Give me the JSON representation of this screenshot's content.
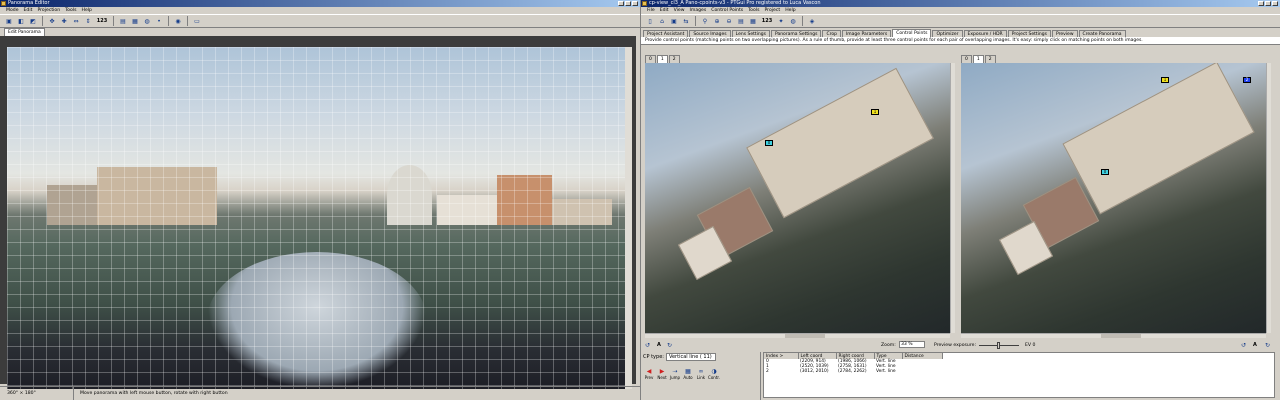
{
  "left_window": {
    "title": "Panorama Editor",
    "menu": [
      "Mode",
      "Edit",
      "Projection",
      "Tools",
      "Help"
    ],
    "toolbar": {
      "icons": [
        "preview-icon",
        "layers-icon",
        "center-icon",
        "fit-icon",
        "straighten-icon",
        "numbers-icon"
      ],
      "numbers_label": "123"
    },
    "tab": "Edit Panorama",
    "status": {
      "projection": "360° × 180° Equirectangular",
      "hint": "Move panorama with left mouse button, rotate with right button"
    }
  },
  "right_window": {
    "title": "cp-view_cl3_A Pano-cpoints-v3 - PTGui Pro registered to Luca Vascon",
    "menu": [
      "File",
      "Edit",
      "View",
      "Images",
      "Control Points",
      "Tools",
      "Project",
      "Help"
    ],
    "toolbar": {
      "numbers_label": "123"
    },
    "tabs": [
      "Project Assistant",
      "Source Images",
      "Lens Settings",
      "Panorama Settings",
      "Crop",
      "Image Parameters",
      "Control Points",
      "Optimizer",
      "Exposure / HDR",
      "Project Settings",
      "Preview",
      "Create Panorama"
    ],
    "active_tab": "Control Points",
    "description": "Provide control points (matching points on two overlapping pictures). As a rule of thumb, provide at least three control points for each pair of overlapping images. It's easy: simply click on matching points on both images.",
    "left_panel": {
      "tabs": [
        "0",
        "1",
        "2"
      ],
      "active": "1",
      "points": [
        "0",
        "1",
        "2"
      ]
    },
    "right_panel": {
      "tabs": [
        "0",
        "1",
        "2"
      ],
      "active": "1",
      "points": [
        "0",
        "1",
        "2"
      ]
    },
    "zoom_label": "Zoom:",
    "zoom_value": "33 %",
    "preview_exposure_label": "Preview exposure:",
    "ev_value": "EV 0",
    "panel_btn_a": "A",
    "cp_type_label": "CP type:",
    "cp_type_value": "Vertical line ( 11)",
    "buttons": [
      "Prev",
      "Next",
      "Jump",
      "Auto",
      "Link",
      "Contr."
    ],
    "table": {
      "headers": [
        "Index >",
        "Left coord",
        "Right coord",
        "Type",
        "Distance"
      ],
      "rows": [
        [
          "0",
          "(2209, 914)",
          "(1986, 1066)",
          "Vert. line",
          ""
        ],
        [
          "1",
          "(2520, 1039)",
          "(2758, 1631)",
          "Vert. line",
          ""
        ],
        [
          "2",
          "(3012, 2010)",
          "(2784, 2262)",
          "Vert. line",
          ""
        ]
      ]
    }
  }
}
